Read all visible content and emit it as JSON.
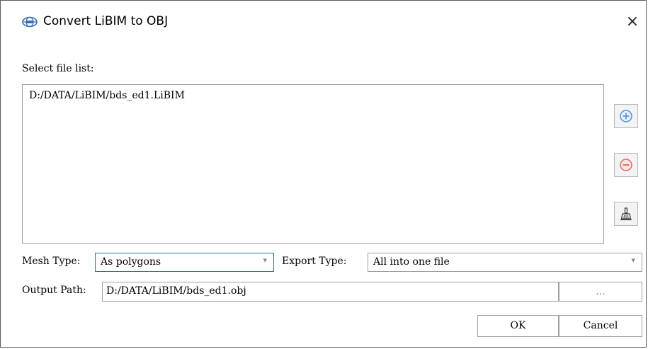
{
  "window": {
    "title": "Convert LiBIM to OBJ",
    "close_glyph": "×",
    "icon": "app-logo-icon"
  },
  "files": {
    "label": "Select file list:",
    "items": [
      "D:/DATA/LiBIM/bds_ed1.LiBIM"
    ],
    "add_icon": "plus-circle-icon",
    "remove_icon": "minus-circle-icon",
    "clear_icon": "broom-icon"
  },
  "mesh_type": {
    "label": "Mesh Type:",
    "value": "As polygons",
    "arrow": "▾"
  },
  "export_type": {
    "label": "Export Type:",
    "value": "All into one file",
    "arrow": "▾"
  },
  "output": {
    "label": "Output Path:",
    "value": "D:/DATA/LiBIM/bds_ed1.obj",
    "browse_label": "..."
  },
  "buttons": {
    "ok_label": "OK",
    "cancel_label": "Cancel"
  },
  "colors": {
    "accent": "#1e73be",
    "add_blue": "#4a90e2",
    "remove_red": "#e06666"
  }
}
